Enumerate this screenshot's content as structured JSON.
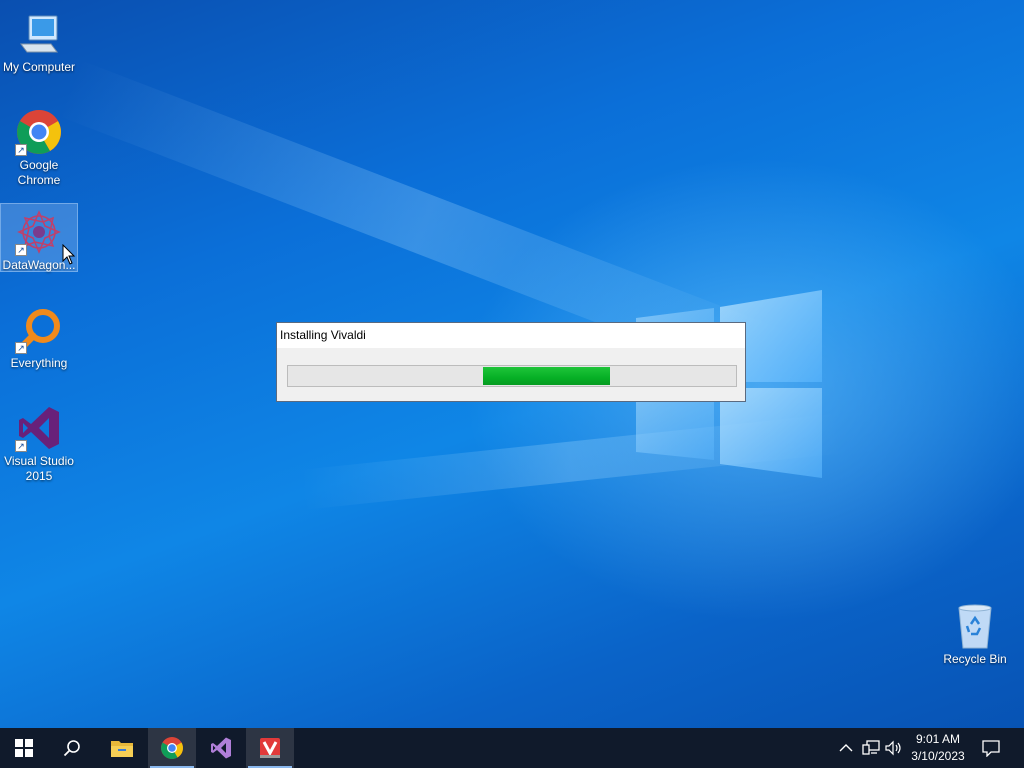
{
  "desktop": {
    "icons": [
      {
        "label": "My Computer"
      },
      {
        "label": "Google Chrome"
      },
      {
        "label": "DataWagon..."
      },
      {
        "label": "Everything"
      },
      {
        "label": "Visual Studio 2015"
      },
      {
        "label": "Recycle Bin"
      }
    ]
  },
  "dialog": {
    "title": "Installing Vivaldi",
    "progress_fill_start": 0.435,
    "progress_fill_end": 0.72,
    "progress_color": "#06b025"
  },
  "taskbar": {
    "background": "#101a2b",
    "pinned": [
      {
        "icon": "windows-start-icon"
      },
      {
        "icon": "search-icon"
      },
      {
        "icon": "file-explorer-icon"
      },
      {
        "icon": "chrome-icon"
      },
      {
        "icon": "visual-studio-icon"
      },
      {
        "icon": "vivaldi-installer-icon"
      }
    ],
    "tray": {
      "icons": [
        "chevron-up-icon",
        "network-icon",
        "volume-icon",
        "notification-icon"
      ],
      "time": "9:01 AM",
      "date": "3/10/2023"
    }
  }
}
